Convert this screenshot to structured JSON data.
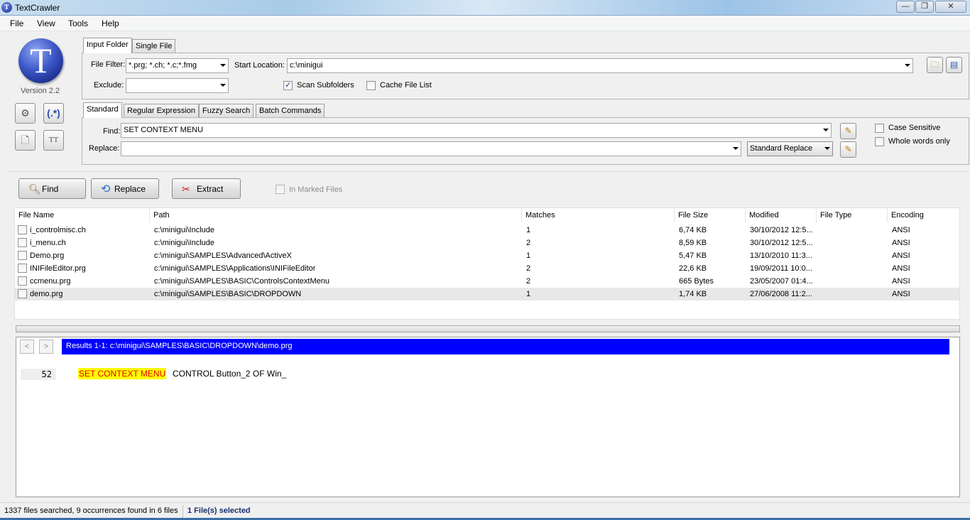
{
  "window": {
    "title": "TextCrawler",
    "minimize": "—",
    "maximize": "❐",
    "close": "✕"
  },
  "menu": {
    "file": "File",
    "view": "View",
    "tools": "Tools",
    "help": "Help"
  },
  "sidebar": {
    "logo_letter": "T",
    "version": "Version 2.2"
  },
  "input_panel": {
    "tabs": [
      "Input Folder",
      "Single File"
    ],
    "file_filter_label": "File Filter:",
    "file_filter_value": "*.prg; *.ch; *.c;*.fmg",
    "start_location_label": "Start Location:",
    "start_location_value": "c:\\minigui",
    "exclude_label": "Exclude:",
    "exclude_value": "",
    "scan_subfolders_label": "Scan Subfolders",
    "scan_subfolders_checked": true,
    "cache_file_list_label": "Cache File List",
    "cache_file_list_checked": false
  },
  "search_panel": {
    "tabs": [
      "Standard",
      "Regular Expression",
      "Fuzzy Search",
      "Batch Commands"
    ],
    "find_label": "Find:",
    "find_value": "SET CONTEXT MENU",
    "replace_label": "Replace:",
    "replace_value": "",
    "replace_mode": "Standard Replace",
    "case_sensitive_label": "Case Sensitive",
    "whole_words_label": "Whole words only"
  },
  "actions": {
    "find": "Find",
    "replace": "Replace",
    "extract": "Extract",
    "in_marked_files": "In Marked Files"
  },
  "grid": {
    "columns": [
      "File Name",
      "Path",
      "Matches",
      "File Size",
      "Modified",
      "File Type",
      "Encoding"
    ],
    "rows": [
      {
        "name": "i_controlmisc.ch",
        "path": "c:\\minigui\\Include",
        "matches": "1",
        "size": "6,74 KB",
        "modified": "30/10/2012 12:5...",
        "type": "",
        "encoding": "ANSI"
      },
      {
        "name": "i_menu.ch",
        "path": "c:\\minigui\\Include",
        "matches": "2",
        "size": "8,59 KB",
        "modified": "30/10/2012 12:5...",
        "type": "",
        "encoding": "ANSI"
      },
      {
        "name": "Demo.prg",
        "path": "c:\\minigui\\SAMPLES\\Advanced\\ActiveX",
        "matches": "1",
        "size": "5,47 KB",
        "modified": "13/10/2010 11:3...",
        "type": "",
        "encoding": "ANSI"
      },
      {
        "name": "INIFileEditor.prg",
        "path": "c:\\minigui\\SAMPLES\\Applications\\INIFileEditor",
        "matches": "2",
        "size": "22,6 KB",
        "modified": "19/09/2011 10:0...",
        "type": "",
        "encoding": "ANSI"
      },
      {
        "name": "ccmenu.prg",
        "path": "c:\\minigui\\SAMPLES\\BASIC\\ControlsContextMenu",
        "matches": "2",
        "size": "665 Bytes",
        "modified": "23/05/2007 01:4...",
        "type": "",
        "encoding": "ANSI"
      },
      {
        "name": "demo.prg",
        "path": "c:\\minigui\\SAMPLES\\BASIC\\DROPDOWN",
        "matches": "1",
        "size": "1,74 KB",
        "modified": "27/06/2008 11:2...",
        "type": "",
        "encoding": "ANSI"
      }
    ]
  },
  "preview": {
    "prev": "<",
    "next": ">",
    "header": "Results 1-1: c:\\minigui\\SAMPLES\\BASIC\\DROPDOWN\\demo.prg",
    "line_number": "52",
    "match_text": "SET CONTEXT MENU",
    "rest_text": "CONTROL Button_2 OF Win_"
  },
  "status": {
    "summary": "1337 files searched, 9 occurrences found in 6 files",
    "selection": "1 File(s) selected"
  },
  "colors": {
    "accent_blue": "#0000ff",
    "highlight_yellow": "#ffff00",
    "match_red": "#e00000"
  }
}
